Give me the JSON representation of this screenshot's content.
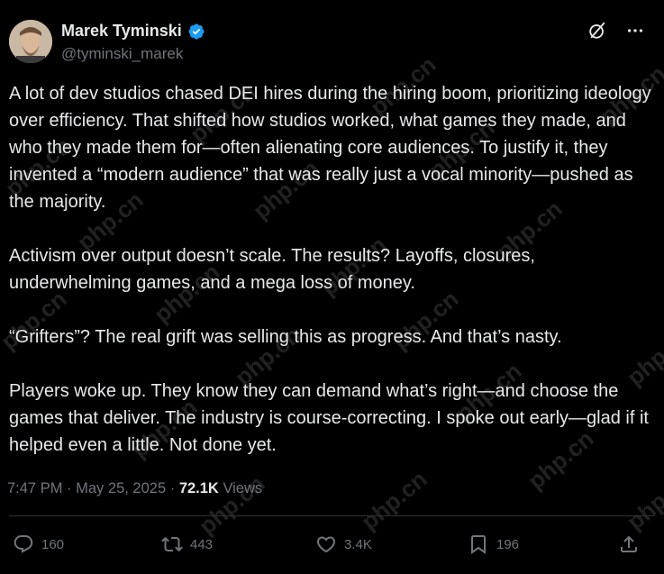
{
  "author": {
    "name": "Marek Tyminski",
    "handle": "@tyminski_marek"
  },
  "post": {
    "paragraphs": [
      "A lot of dev studios chased DEI hires during the hiring boom, prioritizing ideology over efficiency. That shifted how studios worked, what games they made, and who they made them for—often alienating core audiences. To justify it, they invented a “modern audience” that was really just a vocal minority—pushed as the majority.",
      "Activism over output doesn’t scale. The results? Layoffs, closures, underwhelming games, and a mega loss of money.",
      "“Grifters”? The real grift was selling this as progress. And that’s nasty.",
      "Players woke up. They know they can demand what’s right—and choose the games that deliver. The industry is course-correcting. I spoke out early—glad if it helped even a little. Not done yet."
    ]
  },
  "meta": {
    "time": "7:47 PM",
    "separator": "·",
    "date": "May 25, 2025",
    "views_count": "72.1K",
    "views_label": "Views"
  },
  "actions": {
    "replies": "160",
    "reposts": "443",
    "likes": "3.4K",
    "bookmarks": "196"
  },
  "watermark": "php.cn",
  "icons": [
    "verified-badge-icon",
    "grok-icon",
    "more-icon",
    "reply-icon",
    "repost-icon",
    "like-icon",
    "bookmark-icon",
    "share-icon"
  ],
  "colors": {
    "background": "#000000",
    "text": "#e7e9ea",
    "secondary": "#71767b",
    "verified": "#1d9bf0"
  }
}
